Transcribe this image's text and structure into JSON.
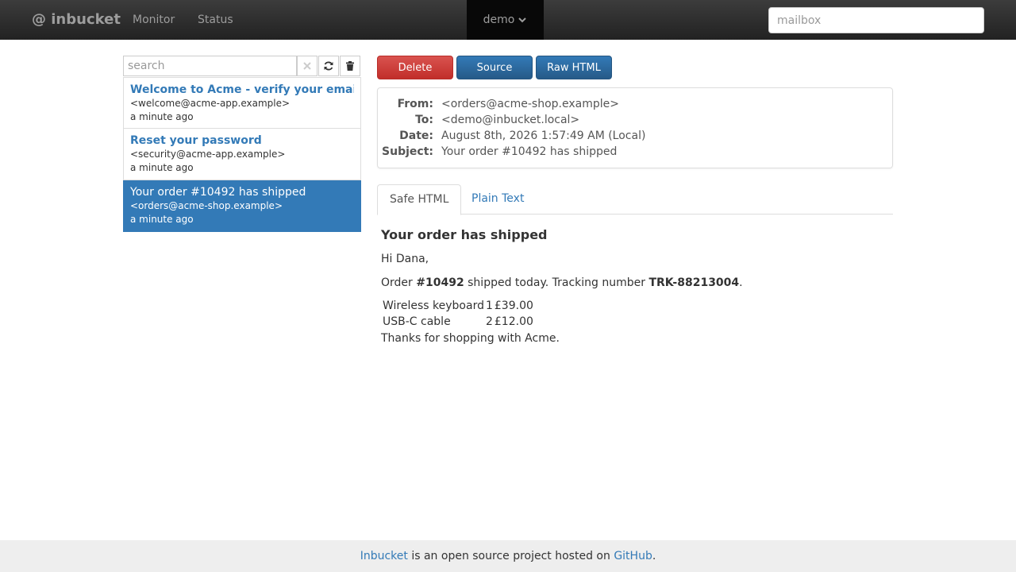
{
  "navbar": {
    "brand": "@ inbucket",
    "links": {
      "monitor": "Monitor",
      "status": "Status"
    },
    "current_mailbox": "demo",
    "mailbox_placeholder": "mailbox"
  },
  "list": {
    "search_placeholder": "search",
    "messages": [
      {
        "subject": "Welcome to Acme - verify your email",
        "from": "<welcome@acme-app.example>",
        "date": "a minute ago",
        "selected": false
      },
      {
        "subject": "Reset your password",
        "from": "<security@acme-app.example>",
        "date": "a minute ago",
        "selected": false
      },
      {
        "subject": "Your order #10492 has shipped",
        "from": "<orders@acme-shop.example>",
        "date": "a minute ago",
        "selected": true
      }
    ]
  },
  "toolbar": {
    "delete_label": "Delete",
    "source_label": "Source",
    "raw_label": "Raw HTML"
  },
  "header": {
    "from_label": "From:",
    "from": "<orders@acme-shop.example>",
    "to_label": "To:",
    "to": "<demo@inbucket.local>",
    "date_label": "Date:",
    "date": "August 8th, 2026 1:57:49 AM (Local)",
    "subject_label": "Subject:",
    "subject": "Your order #10492 has shipped"
  },
  "tabs": {
    "safe_html": "Safe HTML",
    "plain_text": "Plain Text",
    "active": "safe_html"
  },
  "body": {
    "heading": "Your order has shipped",
    "greeting": "Hi Dana,",
    "order_prefix": "Order ",
    "order_number": "#10492",
    "order_middle": " shipped today. Tracking number ",
    "tracking": "TRK-88213004",
    "order_suffix": ".",
    "items": [
      {
        "name": "Wireless keyboard",
        "qty": "1",
        "price": "£39.00"
      },
      {
        "name": "USB-C cable",
        "qty": "2",
        "price": "£12.00"
      }
    ],
    "thanks": "Thanks for shopping with Acme."
  },
  "footer": {
    "inbucket_link": "Inbucket",
    "text": " is an open source project hosted on ",
    "github_link": "GitHub",
    "suffix": "."
  },
  "colors": {
    "navbar_bg": "#222222",
    "link": "#337ab7",
    "danger": "#d9534f",
    "selected_bg": "#337ab7",
    "footer_bg": "#eeeeee"
  }
}
